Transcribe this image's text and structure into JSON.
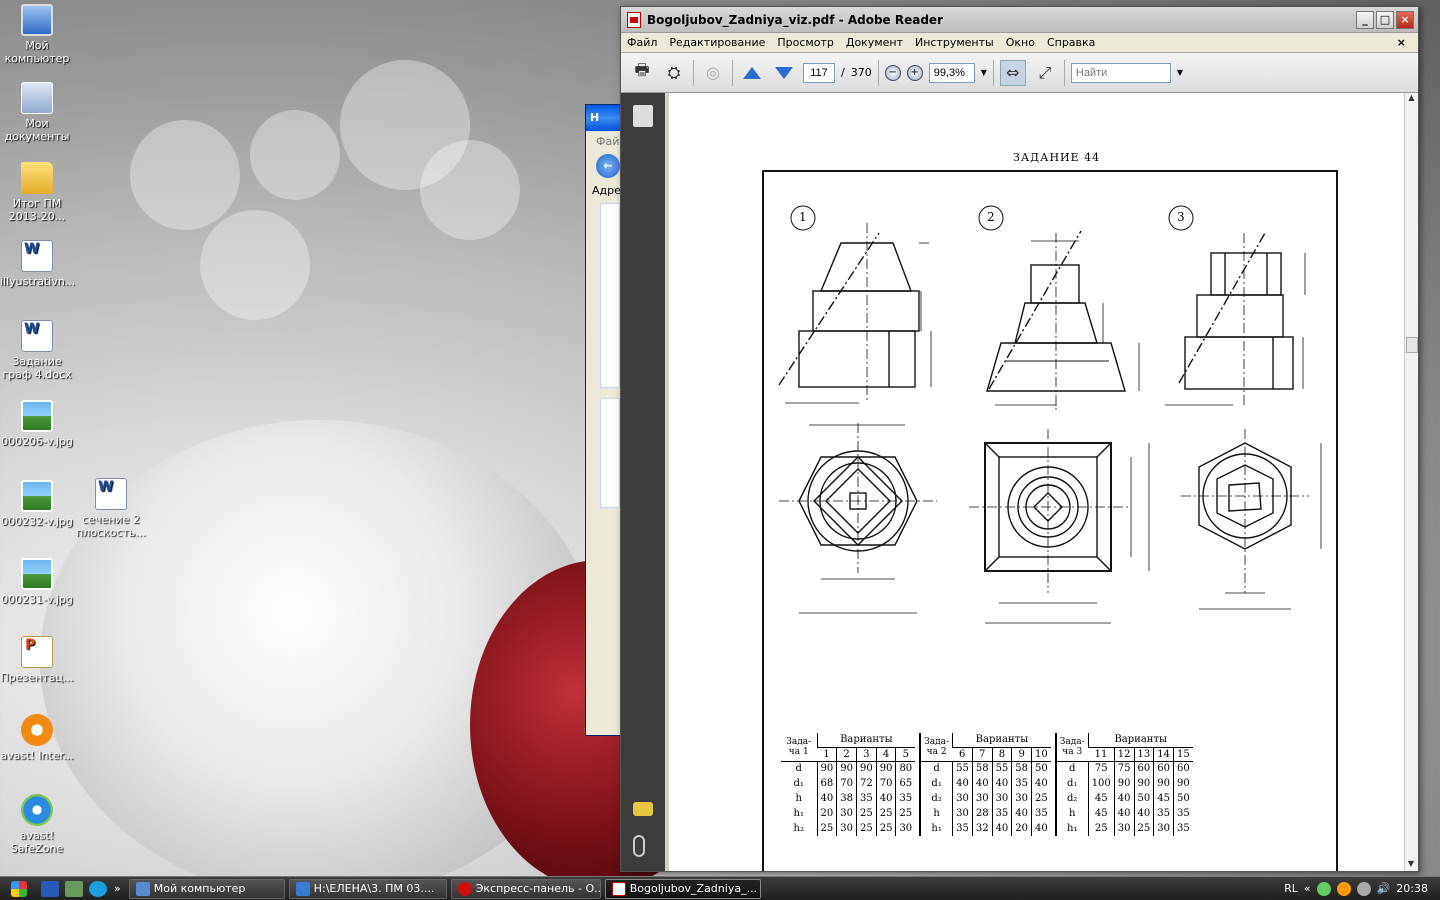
{
  "desktop": {
    "icons": [
      {
        "label": "Мой компьютер",
        "icon": "my-computer-icon"
      },
      {
        "label": "Мои документы",
        "icon": "my-documents-icon"
      },
      {
        "label": "Итог ПМ 2013-20...",
        "icon": "folder-icon"
      },
      {
        "label": "illyustrativn...",
        "icon": "word-document-icon"
      },
      {
        "label": "Задание граф 4.docx",
        "icon": "word-document-icon"
      },
      {
        "label": "000206-v.jpg",
        "icon": "image-file-icon"
      },
      {
        "label": "000232-v.jpg",
        "icon": "image-file-icon"
      },
      {
        "label": "сечение 2 плоскость...",
        "icon": "word-document-icon"
      },
      {
        "label": "000231-v.jpg",
        "icon": "image-file-icon"
      },
      {
        "label": "Презентац...",
        "icon": "presentation-icon"
      },
      {
        "label": "avast! Inter...",
        "icon": "avast-icon"
      },
      {
        "label": "avast! SafeZone",
        "icon": "avast-safezone-icon"
      }
    ]
  },
  "explorer": {
    "title_fragment": "Н",
    "menu_fragment": "Файл",
    "address_fragment": "Адре"
  },
  "reader": {
    "title": "Bogoljubov_Zadniya_viz.pdf - Adobe Reader",
    "menu": [
      "Файл",
      "Редактирование",
      "Просмотр",
      "Документ",
      "Инструменты",
      "Окно",
      "Справка"
    ],
    "menu_close": "×",
    "page_current": "117",
    "page_separator": "/",
    "page_total": "370",
    "zoom": "99,3%",
    "find_placeholder": "Найти"
  },
  "document": {
    "page_title": "ЗАДАНИЕ 44",
    "figure_numbers": [
      "1",
      "2",
      "3"
    ],
    "table1": {
      "corner": "Зада-ча 1",
      "header": "Варианты",
      "variants": [
        "1",
        "2",
        "3",
        "4",
        "5"
      ],
      "rows": [
        {
          "label": "d",
          "values": [
            "90",
            "90",
            "90",
            "90",
            "80"
          ]
        },
        {
          "label": "d₁",
          "values": [
            "68",
            "70",
            "72",
            "70",
            "65"
          ]
        },
        {
          "label": "h",
          "values": [
            "40",
            "38",
            "35",
            "40",
            "35"
          ]
        },
        {
          "label": "h₁",
          "values": [
            "20",
            "30",
            "25",
            "25",
            "25"
          ]
        },
        {
          "label": "h₂",
          "values": [
            "25",
            "30",
            "25",
            "25",
            "30"
          ]
        }
      ]
    },
    "table2": {
      "corner": "Зада-ча 2",
      "header": "Варианты",
      "variants": [
        "6",
        "7",
        "8",
        "9",
        "10"
      ],
      "rows": [
        {
          "label": "d",
          "values": [
            "55",
            "58",
            "55",
            "58",
            "50"
          ]
        },
        {
          "label": "d₁",
          "values": [
            "40",
            "40",
            "40",
            "35",
            "40"
          ]
        },
        {
          "label": "d₂",
          "values": [
            "30",
            "30",
            "30",
            "30",
            "25"
          ]
        },
        {
          "label": "h",
          "values": [
            "30",
            "28",
            "35",
            "40",
            "35"
          ]
        },
        {
          "label": "h₁",
          "values": [
            "35",
            "32",
            "40",
            "20",
            "40"
          ]
        }
      ]
    },
    "table3": {
      "corner": "Зада-ча 3",
      "header": "Варианты",
      "variants": [
        "11",
        "12",
        "13",
        "14",
        "15"
      ],
      "rows": [
        {
          "label": "d",
          "values": [
            "75",
            "75",
            "60",
            "60",
            "60"
          ]
        },
        {
          "label": "d₁",
          "values": [
            "100",
            "90",
            "90",
            "90",
            "90"
          ]
        },
        {
          "label": "d₂",
          "values": [
            "45",
            "40",
            "50",
            "45",
            "50"
          ]
        },
        {
          "label": "h",
          "values": [
            "45",
            "40",
            "40",
            "35",
            "35"
          ]
        },
        {
          "label": "h₁",
          "values": [
            "25",
            "30",
            "25",
            "30",
            "35"
          ]
        }
      ]
    }
  },
  "taskbar": {
    "tasks": [
      {
        "label": "Мой компьютер",
        "icon": "my-computer-icon"
      },
      {
        "label": "H:\\ЕЛЕНА\\3. ПМ 03....",
        "icon": "explorer-icon"
      },
      {
        "label": "Экспресс-панель - О...",
        "icon": "opera-icon"
      },
      {
        "label": "Bogoljubov_Zadniya_...",
        "icon": "pdf-icon"
      }
    ],
    "language": "RL",
    "chevron": "«",
    "quicklaunch_more": "»",
    "clock": "20:38"
  }
}
